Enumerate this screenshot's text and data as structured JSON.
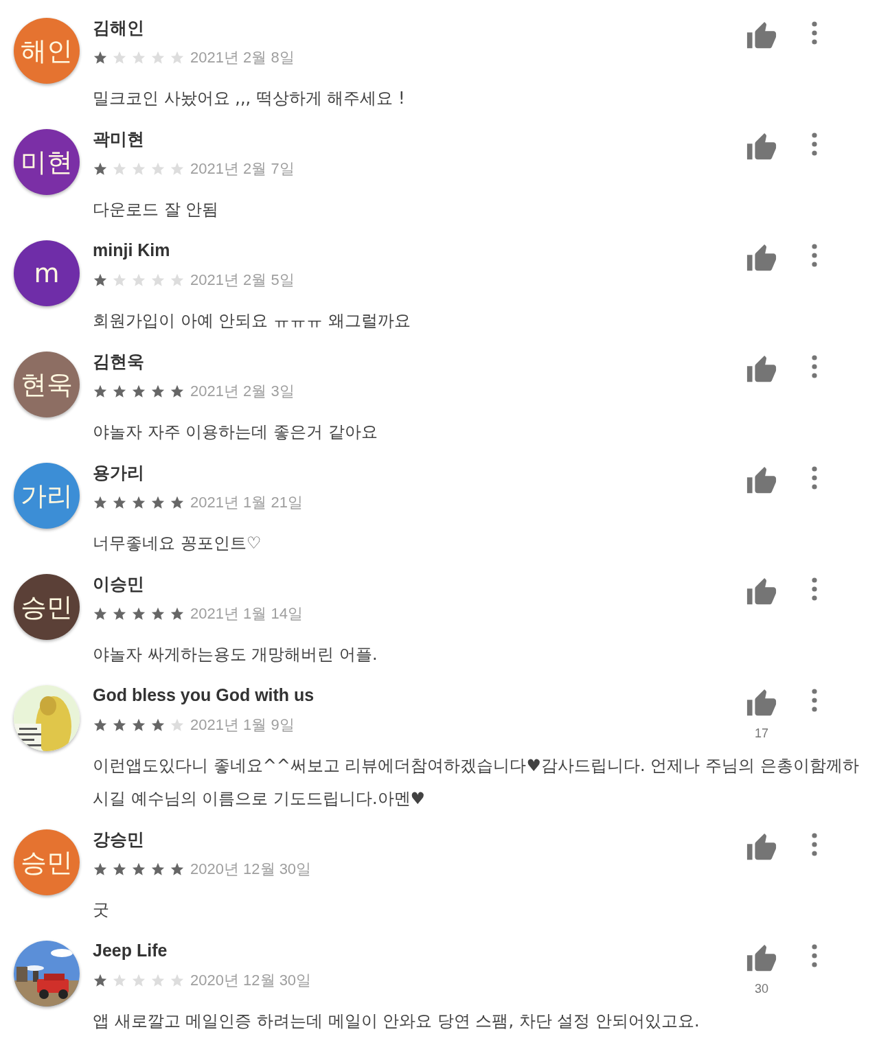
{
  "reviews": [
    {
      "avatar": {
        "kind": "initials",
        "text": "해인",
        "color": "#e57330"
      },
      "name": "김해인",
      "stars": 1,
      "date": "2021년 2월 8일",
      "body": "밀크코인 사놨어요 ,,, 떡상하게 해주세요 !"
    },
    {
      "avatar": {
        "kind": "initials",
        "text": "미현",
        "color": "#7b2fa6"
      },
      "name": "곽미현",
      "stars": 1,
      "date": "2021년 2월 7일",
      "body": "다운로드 잘 안됨"
    },
    {
      "avatar": {
        "kind": "initials",
        "text": "m",
        "color": "#6f2da8"
      },
      "name": "minji Kim",
      "stars": 1,
      "date": "2021년 2월 5일",
      "body": "회원가입이 아예 안되요 ㅠㅠㅠ 왜그럴까요"
    },
    {
      "avatar": {
        "kind": "initials",
        "text": "현욱",
        "color": "#8d6e63"
      },
      "name": "김현욱",
      "stars": 5,
      "date": "2021년 2월 3일",
      "body": "야놀자 자주 이용하는데 좋은거 같아요"
    },
    {
      "avatar": {
        "kind": "initials",
        "text": "가리",
        "color": "#3c8ed6"
      },
      "name": "용가리",
      "stars": 5,
      "date": "2021년 1월 21일",
      "body": "너무좋네요 꽁포인트♡"
    },
    {
      "avatar": {
        "kind": "initials",
        "text": "승민",
        "color": "#5b4037"
      },
      "name": "이승민",
      "stars": 5,
      "date": "2021년 1월 14일",
      "body": "야놀자 싸게하는용도 개망해버린 어플."
    },
    {
      "name": "God bless you God with us",
      "stars": 4,
      "date": "2021년 1월 9일",
      "likes": "17",
      "body": "이런앱도있다니 좋네요^^써보고 리뷰에더참여하겠습니다♥감사드립니다. 언제나 주님의 은총이함께하시길 예수님의 이름으로 기도드립니다.아멘♥"
    },
    {
      "avatar": {
        "kind": "initials",
        "text": "승민",
        "color": "#e57330"
      },
      "name": "강승민",
      "stars": 5,
      "date": "2020년 12월 30일",
      "body": "굿"
    },
    {
      "name": "Jeep Life",
      "stars": 1,
      "date": "2020년 12월 30일",
      "likes": "30",
      "body": "앱 새로깔고 메일인증 하려는데 메일이 안와요 당연 스팸, 차단 설정 안되어있고요."
    }
  ]
}
